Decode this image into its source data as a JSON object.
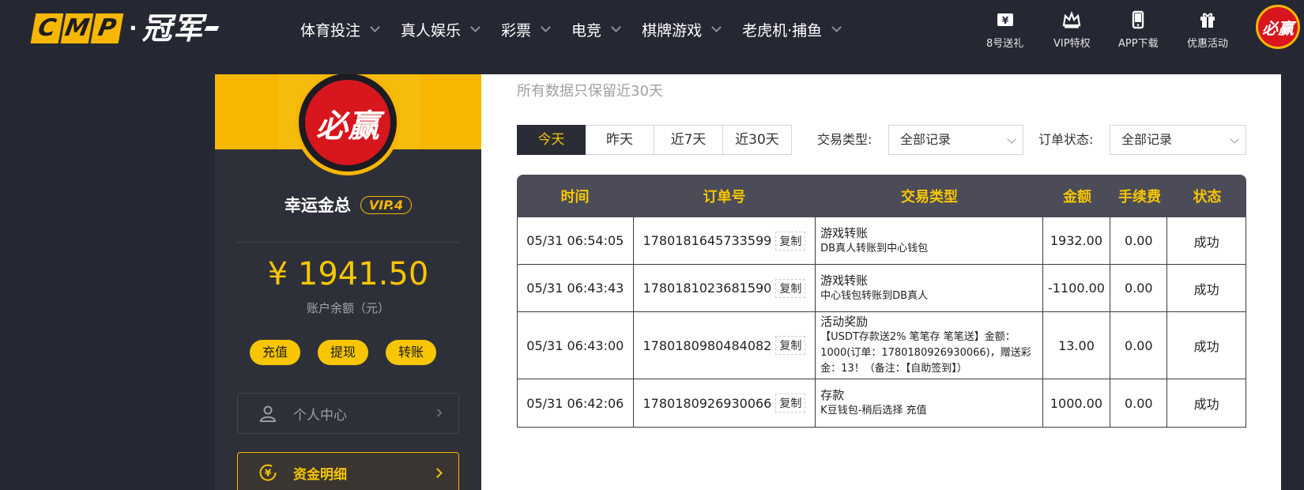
{
  "brand": {
    "logo_letters": [
      "C",
      "M",
      "P"
    ],
    "logo_dot": "·",
    "logo_cn": "冠军"
  },
  "nav": [
    {
      "label": "体育投注"
    },
    {
      "label": "真人娱乐"
    },
    {
      "label": "彩票"
    },
    {
      "label": "电竞"
    },
    {
      "label": "棋牌游戏"
    },
    {
      "label": "老虎机·捕鱼"
    }
  ],
  "quick_links": [
    {
      "label": "8号送礼",
      "icon": "gift-ticket-icon"
    },
    {
      "label": "VIP特权",
      "icon": "crown-icon"
    },
    {
      "label": "APP下载",
      "icon": "phone-icon"
    },
    {
      "label": "优惠活动",
      "icon": "gift-box-icon"
    }
  ],
  "avatar_text": "必赢",
  "profile": {
    "username": "幸运金总",
    "vip": "VIP.4",
    "balance": "¥ 1941.50",
    "balance_label": "账户余额（元）",
    "actions": {
      "deposit": "充值",
      "withdraw": "提现",
      "transfer": "转账"
    },
    "menu": {
      "personal": "个人中心",
      "funds": "资金明细"
    }
  },
  "main": {
    "notice": "所有数据只保留近30天",
    "tabs": [
      {
        "label": "今天",
        "active": true
      },
      {
        "label": "昨天"
      },
      {
        "label": "近7天"
      },
      {
        "label": "近30天"
      }
    ],
    "filters": {
      "type_label": "交易类型:",
      "type_value": "全部记录",
      "status_label": "订单状态:",
      "status_value": "全部记录"
    },
    "table": {
      "headers": {
        "time": "时间",
        "order": "订单号",
        "type": "交易类型",
        "amount": "金额",
        "fee": "手续费",
        "status": "状态"
      },
      "copy_label": "复制",
      "rows": [
        {
          "time": "05/31 06:54:05",
          "order": "1780181645733599",
          "type_title": "游戏转账",
          "type_desc": "DB真人转账到中心钱包",
          "amount": "1932.00",
          "fee": "0.00",
          "status": "成功"
        },
        {
          "time": "05/31 06:43:43",
          "order": "1780181023681590",
          "type_title": "游戏转账",
          "type_desc": "中心钱包转账到DB真人",
          "amount": "-1100.00",
          "fee": "0.00",
          "status": "成功"
        },
        {
          "time": "05/31 06:43:00",
          "order": "1780180980484082",
          "type_title": "活动奖励",
          "type_desc": "【USDT存款送2% 笔笔存 笔笔送】金额：1000(订单：1780180926930066)，赠送彩金：13！（备注：【自助签到】）",
          "amount": "13.00",
          "fee": "0.00",
          "status": "成功"
        },
        {
          "time": "05/31 06:42:06",
          "order": "1780180926930066",
          "type_title": "存款",
          "type_desc": "K豆钱包-稍后选择 充值",
          "amount": "1000.00",
          "fee": "0.00",
          "status": "成功"
        }
      ]
    }
  },
  "colors": {
    "accent": "#f7c600",
    "dark": "#252833",
    "success": "#2e9a2e",
    "brand_red": "#d7161e"
  }
}
